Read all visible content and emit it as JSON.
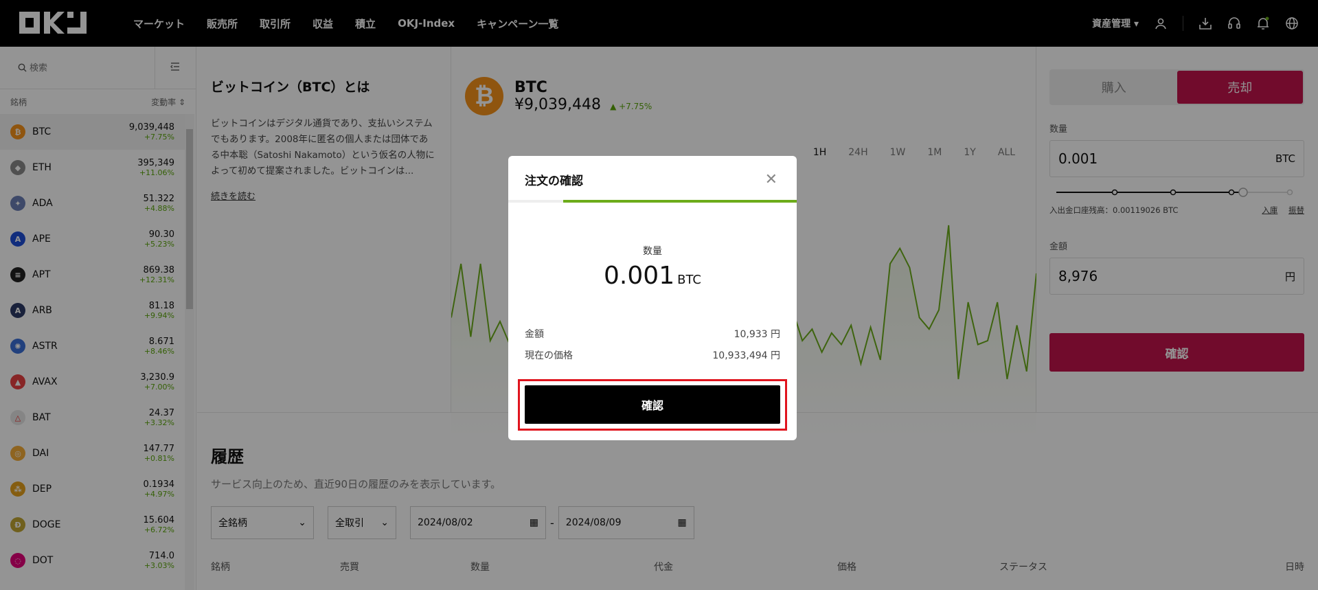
{
  "nav": {
    "logo": "OKJ",
    "menu": [
      "マーケット",
      "販売所",
      "取引所",
      "収益",
      "積立",
      "OKJ-Index",
      "キャンペーン一覧"
    ],
    "asset_menu": "資産管理"
  },
  "sidebar": {
    "search_placeholder": "検索",
    "col_symbol": "銘柄",
    "col_change": "変動率",
    "coins": [
      {
        "sym": "BTC",
        "price": "9,039,448",
        "chg": "+7.75%",
        "color": "#f7931a",
        "glyph": "₿"
      },
      {
        "sym": "ETH",
        "price": "395,349",
        "chg": "+11.06%",
        "color": "#8a8a8a",
        "glyph": "◆"
      },
      {
        "sym": "ADA",
        "price": "51.322",
        "chg": "+4.88%",
        "color": "#6b7fb5",
        "glyph": "✦"
      },
      {
        "sym": "APE",
        "price": "90.30",
        "chg": "+5.23%",
        "color": "#1e4ed8",
        "glyph": "A"
      },
      {
        "sym": "APT",
        "price": "869.38",
        "chg": "+12.31%",
        "color": "#222222",
        "glyph": "≡"
      },
      {
        "sym": "ARB",
        "price": "81.18",
        "chg": "+9.94%",
        "color": "#2b3a67",
        "glyph": "A"
      },
      {
        "sym": "ASTR",
        "price": "8.671",
        "chg": "+8.46%",
        "color": "#3a6fd8",
        "glyph": "✺"
      },
      {
        "sym": "AVAX",
        "price": "3,230.9",
        "chg": "+7.00%",
        "color": "#e84142",
        "glyph": "▲"
      },
      {
        "sym": "BAT",
        "price": "24.37",
        "chg": "+3.32%",
        "color": "#e6e6e6",
        "glyph": "△"
      },
      {
        "sym": "DAI",
        "price": "147.77",
        "chg": "+0.81%",
        "color": "#f5ac37",
        "glyph": "◎"
      },
      {
        "sym": "DEP",
        "price": "0.1934",
        "chg": "+4.97%",
        "color": "#e6a11c",
        "glyph": "⁂"
      },
      {
        "sym": "DOGE",
        "price": "15.604",
        "chg": "+6.72%",
        "color": "#c2a633",
        "glyph": "Ð"
      },
      {
        "sym": "DOT",
        "price": "714.0",
        "chg": "+3.03%",
        "color": "#e6007a",
        "glyph": "◌"
      }
    ]
  },
  "about": {
    "title": "ビットコイン（BTC）とは",
    "body": "ビットコインはデジタル通貨であり、支払いシステムでもあります。2008年に匿名の個人または団体である中本聡（Satoshi Nakamoto）という仮名の人物によって初めて提案されました。ビットコインは...",
    "read_more": "続きを読む"
  },
  "coin": {
    "name": "BTC",
    "price": "¥9,039,448",
    "change": "+7.75%"
  },
  "ranges": [
    "1H",
    "24H",
    "1W",
    "1M",
    "1Y",
    "ALL"
  ],
  "chart_data": {
    "type": "line",
    "x": [
      0,
      1,
      2,
      3,
      4,
      5,
      6,
      7,
      8,
      9,
      10,
      11,
      12,
      13,
      14,
      15,
      16,
      17,
      18,
      19,
      20,
      21,
      22,
      23,
      24,
      25,
      26,
      27,
      28,
      29,
      30,
      31,
      32,
      33,
      34,
      35,
      36,
      37,
      38,
      39,
      40,
      41,
      42,
      43,
      44,
      45,
      46,
      47,
      48,
      49,
      50,
      51,
      52,
      53,
      54,
      55,
      56,
      57,
      58,
      59,
      60
    ],
    "values": [
      52,
      80,
      42,
      80,
      40,
      50,
      38,
      46,
      33,
      45,
      36,
      48,
      30,
      46,
      40,
      50,
      35,
      48,
      36,
      46,
      33,
      50,
      38,
      52,
      30,
      55,
      42,
      50,
      36,
      52,
      38,
      46,
      40,
      48,
      34,
      56,
      40,
      46,
      34,
      44,
      38,
      48,
      28,
      47,
      30,
      80,
      88,
      78,
      52,
      46,
      56,
      100,
      20,
      60,
      38,
      40,
      60,
      20,
      48,
      24,
      75
    ],
    "ylim": [
      0,
      100
    ],
    "color": "#6cac1a"
  },
  "trade": {
    "buy_label": "購入",
    "sell_label": "売却",
    "qty_label": "数量",
    "qty_value": "0.001",
    "qty_unit": "BTC",
    "balance": "入出金口座残高：0.00119026 BTC",
    "deposit": "入庫",
    "transfer": "振替",
    "amount_label": "金額",
    "amount_value": "8,976",
    "amount_unit": "円",
    "confirm": "確認",
    "slider_level": 0.8
  },
  "history": {
    "title": "履歴",
    "note": "サービス向上のため、直近90日の履歴のみを表示しています。",
    "filter_symbol": "全銘柄",
    "filter_type": "全取引",
    "date_from": "2024/08/02",
    "date_to": "2024/08/09",
    "date_sep": "-",
    "columns": [
      "銘柄",
      "売買",
      "数量",
      "代金",
      "価格",
      "ステータス",
      "日時"
    ]
  },
  "modal": {
    "title": "注文の確認",
    "qty_label": "数量",
    "qty_value": "0.001",
    "qty_unit": "BTC",
    "amount_label": "金額",
    "amount_value": "10,933 円",
    "price_label": "現在の価格",
    "price_value": "10,933,494 円",
    "confirm": "確認",
    "step_progress": 0.19
  }
}
